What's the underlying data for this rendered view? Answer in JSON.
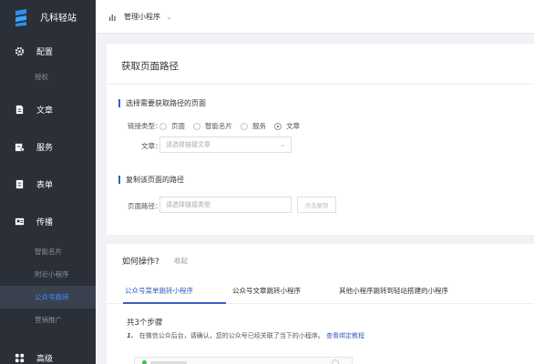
{
  "brand": {
    "name": "凡科轻站"
  },
  "sidebar": {
    "groups": [
      {
        "label": "配置",
        "icon": "gear-icon"
      },
      {
        "label": "文章",
        "icon": "document-icon"
      },
      {
        "label": "服务",
        "icon": "service-icon"
      },
      {
        "label": "表单",
        "icon": "form-icon"
      },
      {
        "label": "传播",
        "icon": "share-icon"
      },
      {
        "label": "高级",
        "icon": "grid-icon"
      }
    ],
    "sub_config": [
      {
        "label": "授权"
      }
    ],
    "sub_spread": [
      {
        "label": "智能名片"
      },
      {
        "label": "附近小程序"
      },
      {
        "label": "公众号跳转"
      },
      {
        "label": "营销推广"
      }
    ]
  },
  "topbar": {
    "label": "管理小程序"
  },
  "card": {
    "title": "获取页面路径",
    "section1": "选择需要获取路径的页面",
    "link_type_label": "链接类型：",
    "radio_options": [
      "页面",
      "智能名片",
      "服务",
      "文章"
    ],
    "selected_index": 3,
    "article_label": "文章：",
    "article_placeholder": "请选择链接文章",
    "section2": "复制该页面的路径",
    "path_label": "页面路径：",
    "path_placeholder": "请选择链接类型",
    "copy_button": "点击复制"
  },
  "help": {
    "title": "如何操作?",
    "collapse": "收起",
    "tabs": [
      "公众号菜单跳转小程序",
      "公众号文章跳转小程序",
      "其他小程序跳转到轻站搭建的小程序"
    ],
    "steps_title": "共3个步骤",
    "step1_num": "1.",
    "step1_text": "在微信公众后台，请确认，您的公众号已经关联了当下的小程序。",
    "step1_link": "查看绑定教程"
  }
}
